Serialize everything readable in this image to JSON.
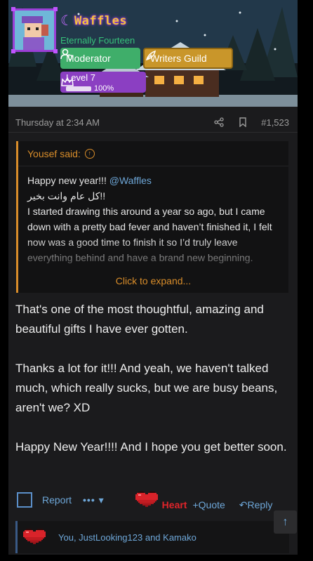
{
  "profile": {
    "username": "Waffles",
    "user_title": "Eternally Fourteen",
    "badges": [
      {
        "label": "Moderator",
        "icon": "user-shield-icon",
        "color": "#3fae6a"
      },
      {
        "label": "Writers Guild",
        "icon": "feather-icon",
        "color": "#c9962a"
      }
    ],
    "level": {
      "label": "Level 7",
      "progress_label": "100%",
      "progress": 1.0,
      "icon": "crown-icon",
      "color": "#8b3fc2"
    }
  },
  "post": {
    "timestamp": "Thursday at 2:34 AM",
    "post_number": "#1,523",
    "share_icon": "share-icon",
    "bookmark_icon": "bookmark-icon"
  },
  "quote": {
    "author_label": "Yousef said:",
    "lines": [
      {
        "text": "Happy new year!!! ",
        "mention": "@Waffles"
      },
      {
        "text": "!!كل عام وانت بخير"
      },
      {
        "text": "I started drawing this around a year so ago, but I came down with a pretty bad fever and haven’t finished it, I felt now was a good time to finish it so I’d truly leave everything behind and have a brand new beginning."
      }
    ],
    "expand_label": "Click to expand..."
  },
  "message": {
    "paragraphs": [
      "That's one of the most thoughtful, amazing and beautiful gifts I have ever gotten.",
      "Thanks a lot for it!!! And yeah, we haven't talked much, which really sucks, but we are busy beans, aren't we? XD",
      "Happy New Year!!!! And I hope you get better soon."
    ]
  },
  "actions": {
    "report": "Report",
    "more": "•••",
    "heart": "Heart",
    "quote": "Quote",
    "reply": "Reply"
  },
  "reactions": {
    "text": "You, JustLooking123 and Kamako",
    "icon": "pixel-heart-icon"
  },
  "colors": {
    "accent_orange": "#d98d2a",
    "link_blue": "#6ea7d8",
    "heart_red": "#e0242a",
    "background": "#1b1b1d"
  }
}
